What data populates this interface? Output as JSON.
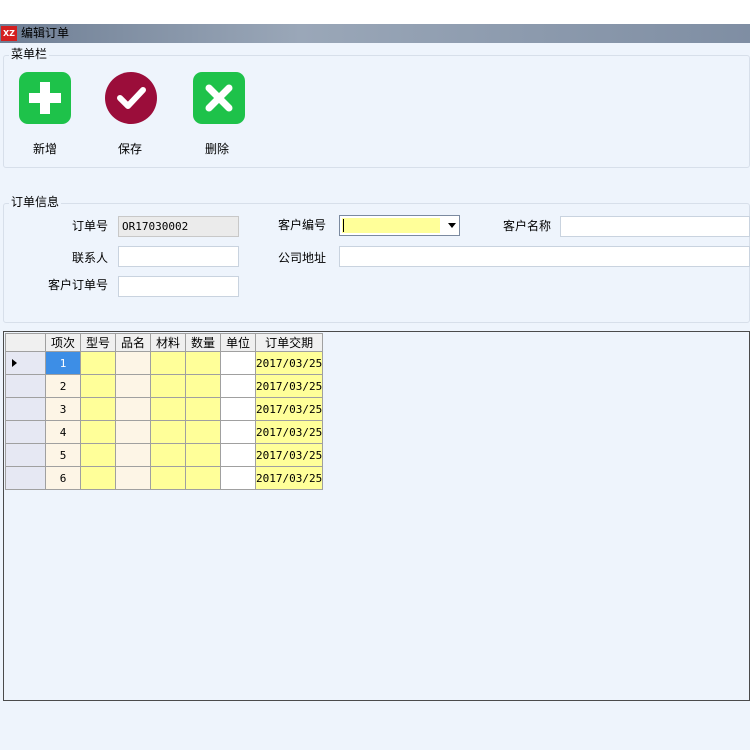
{
  "window": {
    "icon_text": "XZ",
    "title": "编辑订单"
  },
  "colors": {
    "add": "#1ec24a",
    "save": "#9b0d3a",
    "delete": "#1ec24a",
    "highlight": "#ffff99",
    "selected": "#3d8ee6"
  },
  "menu_group": {
    "title": "菜单栏",
    "buttons": [
      {
        "icon": "plus-icon",
        "label": "新增"
      },
      {
        "icon": "check-icon",
        "label": "保存"
      },
      {
        "icon": "cross-icon",
        "label": "删除"
      }
    ]
  },
  "order_info": {
    "title": "订单信息",
    "order_no": {
      "label": "订单号",
      "value": "OR17030002"
    },
    "customer_no": {
      "label": "客户编号",
      "value": ""
    },
    "customer_name": {
      "label": "客户名称",
      "value": ""
    },
    "contact": {
      "label": "联系人",
      "value": ""
    },
    "company_address": {
      "label": "公司地址",
      "value": ""
    },
    "customer_order_no": {
      "label": "客户订单号",
      "value": ""
    }
  },
  "grid": {
    "columns": [
      "项次",
      "型号",
      "品名",
      "材料",
      "数量",
      "单位",
      "订单交期"
    ],
    "rows": [
      {
        "seq": "1",
        "model": "",
        "name": "",
        "material": "",
        "qty": "",
        "unit": "",
        "due": "2017/03/25",
        "selected": true
      },
      {
        "seq": "2",
        "model": "",
        "name": "",
        "material": "",
        "qty": "",
        "unit": "",
        "due": "2017/03/25"
      },
      {
        "seq": "3",
        "model": "",
        "name": "",
        "material": "",
        "qty": "",
        "unit": "",
        "due": "2017/03/25"
      },
      {
        "seq": "4",
        "model": "",
        "name": "",
        "material": "",
        "qty": "",
        "unit": "",
        "due": "2017/03/25"
      },
      {
        "seq": "5",
        "model": "",
        "name": "",
        "material": "",
        "qty": "",
        "unit": "",
        "due": "2017/03/25"
      },
      {
        "seq": "6",
        "model": "",
        "name": "",
        "material": "",
        "qty": "",
        "unit": "",
        "due": "2017/03/25"
      }
    ]
  }
}
